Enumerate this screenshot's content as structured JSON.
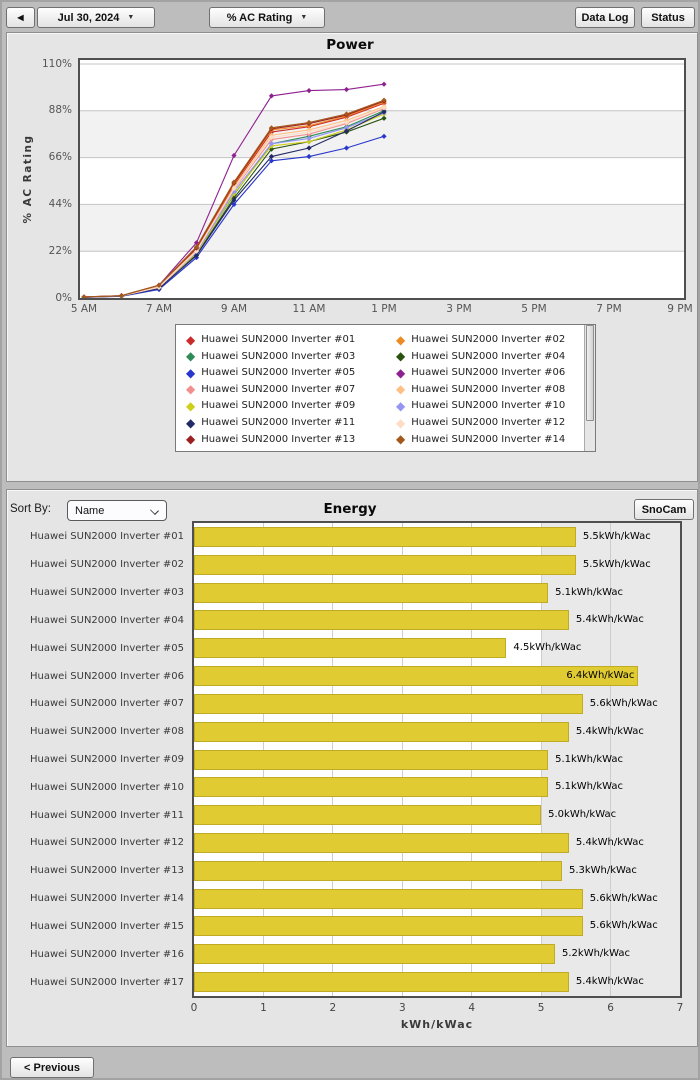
{
  "toolbar": {
    "back_icon": "◀",
    "date_label": "Jul 30, 2024",
    "metric_label": "% AC Rating",
    "dropdown_caret": "▼",
    "data_log_label": "Data Log",
    "status_label": "Status"
  },
  "energy_header": {
    "sort_by_label": "Sort By:",
    "sort_value": "Name",
    "snocam_label": "SnoCam"
  },
  "footer": {
    "previous_label": "< Previous"
  },
  "chart_data": [
    {
      "type": "line",
      "title": "Power",
      "ylabel": "% AC Rating",
      "ylim": [
        0,
        110
      ],
      "yticks": [
        0,
        22,
        44,
        66,
        88,
        110
      ],
      "ytick_suffix": "%",
      "xlim_hours": [
        5,
        21
      ],
      "xticks": {
        "hours": [
          5,
          7,
          9,
          11,
          13,
          15,
          17,
          19,
          21
        ],
        "labels": [
          "5 AM",
          "7 AM",
          "9 AM",
          "11 AM",
          "1 PM",
          "3 PM",
          "5 PM",
          "7 PM",
          "9 PM"
        ]
      },
      "x_hours": [
        5,
        6,
        7,
        8,
        9,
        10,
        11,
        12,
        13
      ],
      "band_color": "#F2F2F2",
      "series": [
        {
          "name": "Huawei SUN2000 Inverter #01",
          "color": "#CB2A2A",
          "values": [
            0.5,
            1.0,
            5.5,
            23.0,
            53.0,
            78.0,
            80.5,
            85.0,
            91.5
          ]
        },
        {
          "name": "Huawei SUN2000 Inverter #02",
          "color": "#EE8A22",
          "values": [
            0.5,
            1.0,
            5.5,
            23.5,
            53.5,
            79.0,
            81.0,
            85.5,
            92.0
          ]
        },
        {
          "name": "Huawei SUN2000 Inverter #03",
          "color": "#2E8B57",
          "values": [
            0.4,
            0.9,
            5.0,
            21.5,
            48.5,
            72.5,
            76.0,
            80.5,
            88.0
          ]
        },
        {
          "name": "Huawei SUN2000 Inverter #04",
          "color": "#2A520F",
          "values": [
            0.4,
            0.9,
            4.5,
            20.5,
            47.0,
            70.0,
            73.5,
            78.0,
            84.5
          ]
        },
        {
          "name": "Huawei SUN2000 Inverter #05",
          "color": "#2736CC",
          "values": [
            0.3,
            0.8,
            4.0,
            19.0,
            44.0,
            64.5,
            66.5,
            70.5,
            76.0
          ]
        },
        {
          "name": "Huawei SUN2000 Inverter #06",
          "color": "#8E2190",
          "values": [
            0.5,
            1.0,
            6.0,
            26.0,
            67.0,
            95.0,
            97.5,
            98.0,
            100.5
          ]
        },
        {
          "name": "Huawei SUN2000 Inverter #07",
          "color": "#F29090",
          "values": [
            0.5,
            1.0,
            5.0,
            22.0,
            51.0,
            74.5,
            77.0,
            82.0,
            89.0
          ]
        },
        {
          "name": "Huawei SUN2000 Inverter #08",
          "color": "#FFC083",
          "values": [
            0.5,
            1.0,
            5.5,
            22.5,
            52.0,
            76.5,
            79.0,
            83.5,
            90.0
          ]
        },
        {
          "name": "Huawei SUN2000 Inverter #09",
          "color": "#CFCF1B",
          "values": [
            0.4,
            0.9,
            5.0,
            21.0,
            49.0,
            71.5,
            73.5,
            79.0,
            86.5
          ]
        },
        {
          "name": "Huawei SUN2000 Inverter #10",
          "color": "#9595F5",
          "values": [
            0.4,
            0.9,
            5.0,
            21.5,
            50.0,
            72.5,
            75.0,
            80.0,
            87.0
          ]
        },
        {
          "name": "Huawei SUN2000 Inverter #11",
          "color": "#232B66",
          "values": [
            0.4,
            0.9,
            4.5,
            20.0,
            46.0,
            66.5,
            70.5,
            78.5,
            87.5
          ]
        },
        {
          "name": "Huawei SUN2000 Inverter #12",
          "color": "#FFDCC4",
          "values": [
            0.5,
            1.0,
            5.0,
            22.0,
            51.5,
            75.5,
            78.0,
            82.5,
            89.5
          ]
        },
        {
          "name": "Huawei SUN2000 Inverter #13",
          "color": "#9E1F1F",
          "values": [
            0.5,
            1.1,
            6.0,
            23.5,
            54.0,
            79.5,
            82.0,
            86.0,
            92.5
          ]
        },
        {
          "name": "Huawei SUN2000 Inverter #14",
          "color": "#A3591B",
          "values": [
            0.5,
            1.1,
            6.0,
            24.0,
            54.5,
            80.0,
            82.5,
            86.5,
            93.0
          ]
        }
      ]
    },
    {
      "type": "bar",
      "orientation": "horizontal",
      "title": "Energy",
      "xlabel": "kWh/kWac",
      "unit": "kWh/kWac",
      "xlim": [
        0,
        7
      ],
      "xticks": [
        0,
        1,
        2,
        3,
        4,
        5,
        6,
        7
      ],
      "bar_color": "#E0CB32",
      "shaded_region": {
        "from": 5,
        "to": 7,
        "color": "#E9E9E9"
      },
      "categories": [
        "Huawei SUN2000 Inverter #01",
        "Huawei SUN2000 Inverter #02",
        "Huawei SUN2000 Inverter #03",
        "Huawei SUN2000 Inverter #04",
        "Huawei SUN2000 Inverter #05",
        "Huawei SUN2000 Inverter #06",
        "Huawei SUN2000 Inverter #07",
        "Huawei SUN2000 Inverter #08",
        "Huawei SUN2000 Inverter #09",
        "Huawei SUN2000 Inverter #10",
        "Huawei SUN2000 Inverter #11",
        "Huawei SUN2000 Inverter #12",
        "Huawei SUN2000 Inverter #13",
        "Huawei SUN2000 Inverter #14",
        "Huawei SUN2000 Inverter #15",
        "Huawei SUN2000 Inverter #16",
        "Huawei SUN2000 Inverter #17"
      ],
      "values": [
        5.5,
        5.5,
        5.1,
        5.4,
        4.5,
        6.4,
        5.6,
        5.4,
        5.1,
        5.1,
        5.0,
        5.4,
        5.3,
        5.6,
        5.6,
        5.2,
        5.4
      ]
    }
  ]
}
